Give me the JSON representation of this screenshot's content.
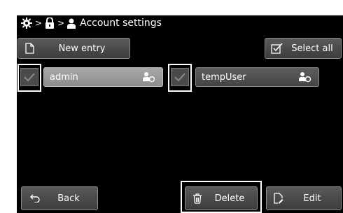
{
  "header": {
    "crumbs": [
      "gear-icon",
      "lock-icon",
      "user-icon"
    ],
    "title": "Account settings"
  },
  "toolbar": {
    "new_entry_label": "New entry",
    "select_all_label": "Select all"
  },
  "users": [
    {
      "name": "admin",
      "checked": true,
      "selected": true
    },
    {
      "name": "tempUser",
      "checked": true,
      "selected": false
    }
  ],
  "footer": {
    "back_label": "Back",
    "delete_label": "Delete",
    "edit_label": "Edit"
  },
  "colors": {
    "background": "#000000",
    "button": "#4a4a4a",
    "selected_user": "#9a9a9a",
    "highlight_frame": "#ffffff"
  }
}
